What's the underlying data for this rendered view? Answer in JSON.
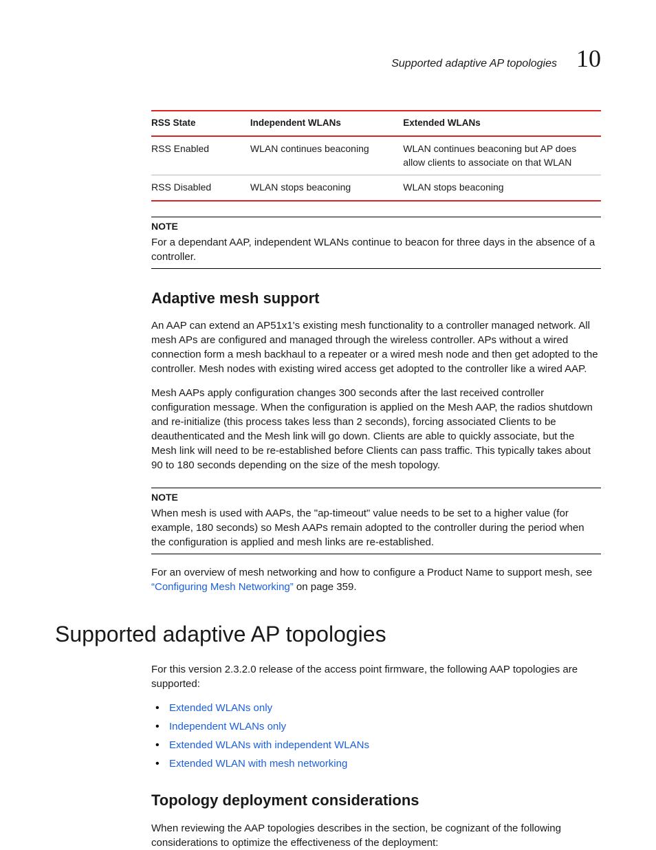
{
  "header": {
    "running_title": "Supported adaptive AP topologies",
    "chapter_number": "10"
  },
  "chart_data": {
    "type": "table",
    "title": "",
    "columns": [
      "RSS State",
      "Independent WLANs",
      "Extended WLANs"
    ],
    "rows": [
      [
        "RSS Enabled",
        "WLAN continues beaconing",
        "WLAN continues beaconing but AP does allow clients to associate on that WLAN"
      ],
      [
        "RSS Disabled",
        "WLAN stops beaconing",
        "WLAN stops beaconing"
      ]
    ]
  },
  "note1": {
    "label": "NOTE",
    "body": "For a dependant AAP, independent WLANs continue to beacon for three days in the absence of a controller."
  },
  "section1": {
    "heading": "Adaptive mesh support",
    "p1": "An AAP can extend an AP51x1's existing mesh functionality to a controller managed network. All mesh APs are configured and managed through the wireless controller. APs without a wired connection form a mesh backhaul to a repeater or a wired mesh node and then get adopted to the controller. Mesh nodes with existing wired access get adopted to the controller like a wired AAP.",
    "p2": "Mesh AAPs apply configuration changes 300 seconds after the last received controller configuration message. When the configuration is applied on the Mesh AAP, the radios shutdown and re-initialize (this process takes less than 2 seconds), forcing associated Clients to be deauthenticated and the Mesh link will go down. Clients are able to quickly associate, but the Mesh link will need to be re-established before Clients can pass traffic. This typically takes about 90 to 180 seconds depending on the size of the mesh topology."
  },
  "note2": {
    "label": "NOTE",
    "body": "When mesh is used with AAPs, the \"ap-timeout\" value needs to be set to a higher value (for example, 180 seconds) so Mesh AAPs remain adopted to the controller during the period when the configuration is applied and mesh links are re-established."
  },
  "crossref": {
    "pre": "For an overview of mesh networking and how to configure a Product Name to support mesh, see ",
    "link": "“Configuring Mesh Networking”",
    "post": " on page 359."
  },
  "h1": "Supported adaptive AP topologies",
  "intro": "For this version 2.3.2.0 release of the access point firmware, the following AAP topologies are supported:",
  "bullets": [
    "Extended WLANs only",
    "Independent WLANs only",
    "Extended WLANs with independent WLANs",
    "Extended WLAN with mesh networking"
  ],
  "section2": {
    "heading": "Topology deployment considerations",
    "p1": "When reviewing the AAP topologies describes in the section, be cognizant of the following considerations to optimize the effectiveness of the deployment:"
  }
}
